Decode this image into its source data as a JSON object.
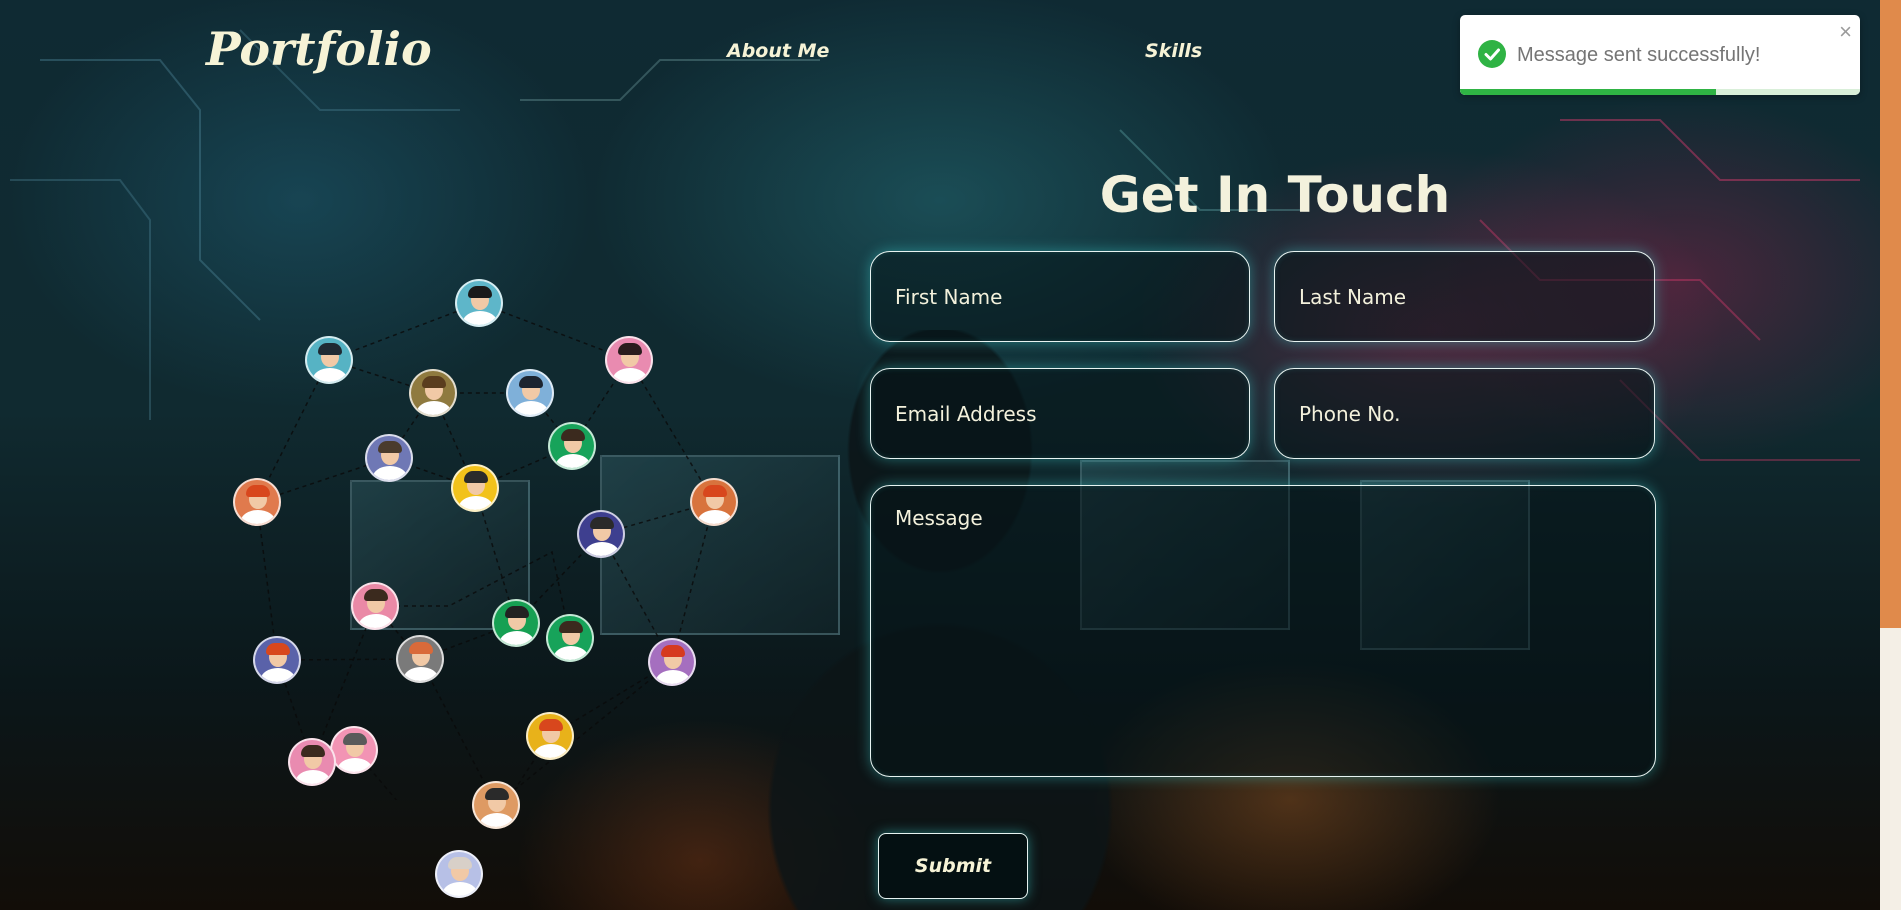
{
  "header": {
    "logo": "Portfolio",
    "nav": [
      "About Me",
      "Skills"
    ]
  },
  "form": {
    "title": "Get In Touch",
    "first_name_placeholder": "First Name",
    "last_name_placeholder": "Last Name",
    "email_placeholder": "Email Address",
    "phone_placeholder": "Phone No.",
    "message_placeholder": "Message",
    "submit_label": "Submit"
  },
  "toast": {
    "message": "Message sent successfully!",
    "icon": "check-circle-icon",
    "close_icon": "close-icon",
    "progress_remaining": 0.64,
    "color": "#2fb344"
  },
  "colors": {
    "accent_glow": "#3cd2d2",
    "text_cream": "#f3f1dc",
    "scrollbar": "#e08a4b"
  }
}
